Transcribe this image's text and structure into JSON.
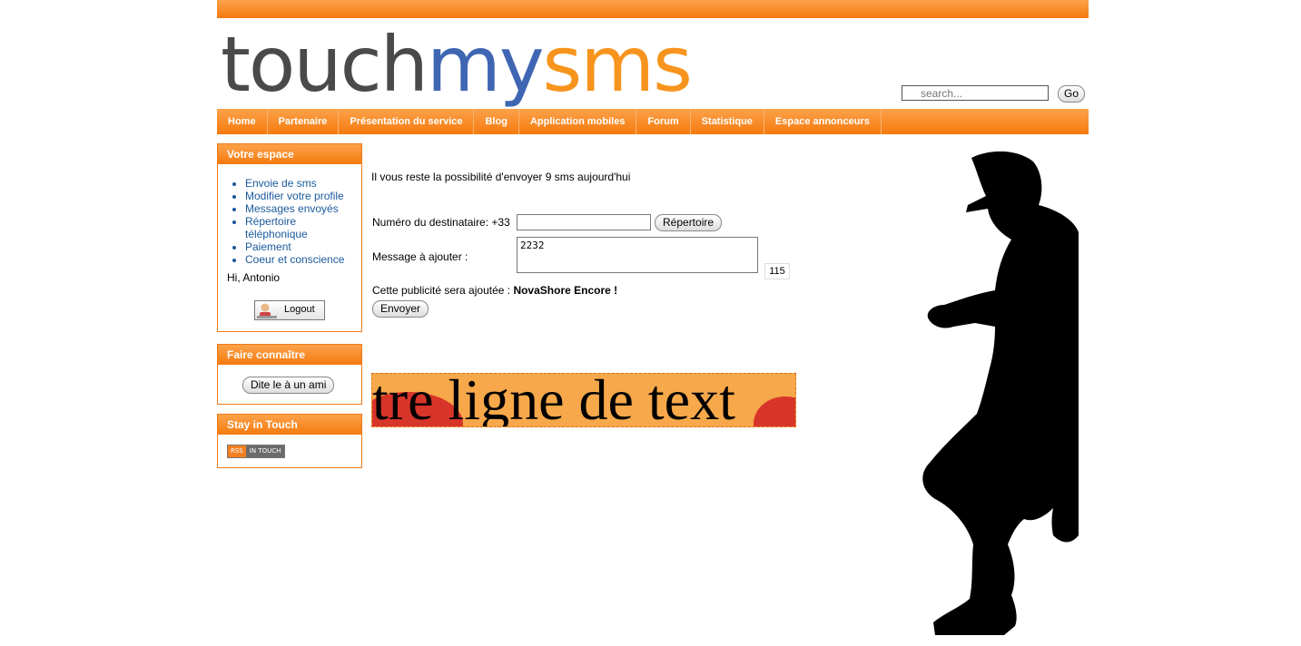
{
  "logo": {
    "part1": "touch",
    "part2": "my",
    "part3": "sms"
  },
  "search": {
    "placeholder": "search...",
    "go_label": "Go"
  },
  "nav": {
    "items": [
      "Home",
      "Partenaire",
      "Présentation du service",
      "Blog",
      "Application mobiles",
      "Forum",
      "Statistique",
      "Espace annonceurs"
    ]
  },
  "sidebar": {
    "votre_espace": {
      "title": "Votre espace",
      "items": [
        "Envoie de sms",
        "Modifier votre profile",
        "Messages envoyés",
        "Répertoire téléphonique",
        "Paiement",
        "Coeur et conscience"
      ],
      "greeting": "Hi, Antonio",
      "logout_label": "Logout"
    },
    "faire_connaitre": {
      "title": "Faire connaître",
      "button_label": "Dite le à un ami"
    },
    "stay_in_touch": {
      "title": "Stay in Touch",
      "rss_label": "RSS",
      "rss_text": "IN TOUCH"
    }
  },
  "main": {
    "info": "Il vous reste la possibilité d'envoyer 9 sms aujourd'hui",
    "recipient_label": "Numéro du destinataire: +33",
    "recipient_value": "",
    "repertoire_label": "Répertoire",
    "message_label": "Message à ajouter :",
    "message_value": "2232",
    "counter": "115",
    "pub_prefix": "Cette publicité sera ajoutée :",
    "pub_name": "NovaShore Encore !",
    "send_label": "Envoyer",
    "banner_text": "tre ligne de text"
  },
  "colors": {
    "orange": "#f57a0e",
    "link": "#1a5a9c",
    "logo_grey": "#4a4a4a",
    "logo_blue": "#3f66b3",
    "logo_orange": "#f7941d"
  }
}
